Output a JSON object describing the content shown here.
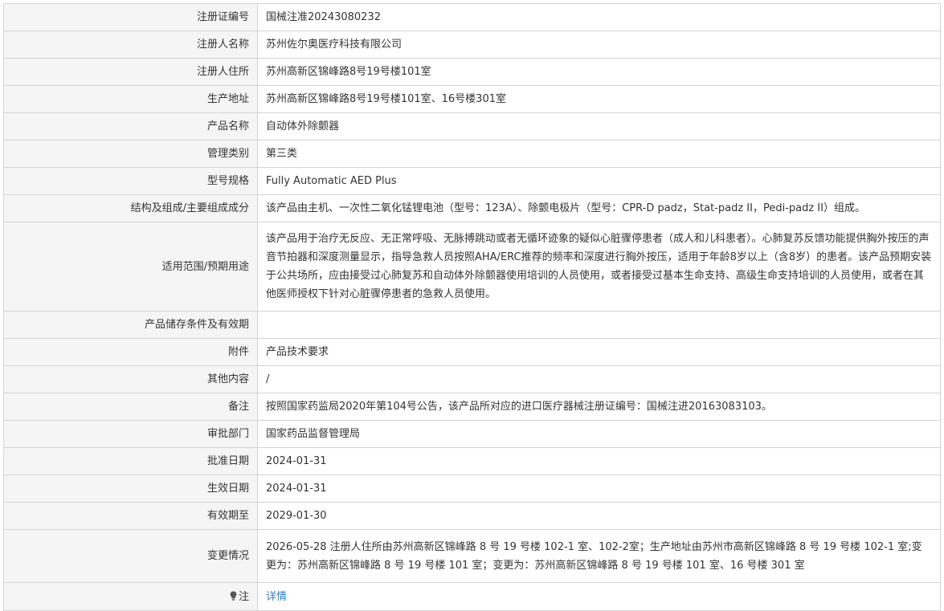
{
  "rows": [
    {
      "label": "注册证编号",
      "value": "国械注准20243080232"
    },
    {
      "label": "注册人名称",
      "value": "苏州佐尔奥医疗科技有限公司"
    },
    {
      "label": "注册人住所",
      "value": "苏州高新区锦峰路8号19号楼101室"
    },
    {
      "label": "生产地址",
      "value": "苏州高新区锦峰路8号19号楼101室、16号楼301室"
    },
    {
      "label": "产品名称",
      "value": "自动体外除颤器"
    },
    {
      "label": "管理类别",
      "value": "第三类"
    },
    {
      "label": "型号规格",
      "value": "Fully Automatic AED Plus"
    },
    {
      "label": "结构及组成/主要组成成分",
      "value": "该产品由主机、一次性二氧化锰锂电池（型号：123A）、除颤电极片（型号：CPR-D padz，Stat-padz II，Pedi-padz II）组成。"
    },
    {
      "label": "适用范围/预期用途",
      "value": "该产品用于治疗无反应、无正常呼吸、无脉搏跳动或者无循环迹象的疑似心脏骤停患者（成人和儿科患者）。心肺复苏反馈功能提供胸外按压的声音节拍器和深度测量显示，指导急救人员按照AHA/ERC推荐的频率和深度进行胸外按压，适用于年龄8岁以上（含8岁）的患者。该产品预期安装于公共场所，应由接受过心肺复苏和自动体外除颤器使用培训的人员使用，或者接受过基本生命支持、高级生命支持培训的人员使用，或者在其他医师授权下针对心脏骤停患者的急救人员使用。"
    },
    {
      "label": "产品储存条件及有效期",
      "value": ""
    },
    {
      "label": "附件",
      "value": "产品技术要求"
    },
    {
      "label": "其他内容",
      "value": "/"
    },
    {
      "label": "备注",
      "value": "按照国家药监局2020年第104号公告，该产品所对应的进口医疗器械注册证编号：国械注进20163083103。"
    },
    {
      "label": "审批部门",
      "value": "国家药品监督管理局"
    },
    {
      "label": "批准日期",
      "value": "2024-01-31"
    },
    {
      "label": "生效日期",
      "value": "2024-01-31"
    },
    {
      "label": "有效期至",
      "value": "2029-01-30"
    },
    {
      "label": "变更情况",
      "value": "2026-05-28 注册人住所由苏州高新区锦峰路 8 号 19 号楼 102-1 室、102-2室；生产地址由苏州市高新区锦峰路 8 号 19 号楼 102-1 室;变更为：苏州高新区锦峰路 8 号 19 号楼 101 室；变更为：苏州高新区锦峰路 8 号 19 号楼 101 室、16 号楼 301 室"
    }
  ],
  "note": {
    "label": "注",
    "icon": "lightbulb-icon",
    "link": "详情"
  },
  "colors": {
    "label_bg": "#f5f5f5",
    "border": "#d4d4d4",
    "link": "#2a7fc6"
  }
}
